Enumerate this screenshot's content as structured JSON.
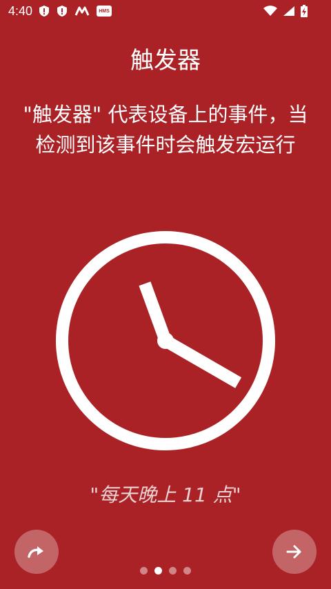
{
  "status_bar": {
    "time": "4:40",
    "hms_label": "HMS",
    "left_icons": [
      "shield-icon",
      "shield-icon",
      "m-logo-icon",
      "hms-badge"
    ],
    "right_icons": [
      "wifi-icon",
      "signal-icon",
      "battery-icon"
    ]
  },
  "intro": {
    "title": "触发器",
    "description": "\"触发器\" 代表设备上的事件，当检测到该事件时会触发宏运行",
    "caption": "\"每天晚上 11 点\"",
    "clock": {
      "hour": 11,
      "minute": 20
    }
  },
  "buttons": {
    "skip_icon": "skip-arrow-icon",
    "next_icon": "arrow-right-icon"
  },
  "pager": {
    "total": 4,
    "active_index": 1
  },
  "colors": {
    "background": "#AA2226",
    "foreground": "#FFFFFF",
    "caption": "#E9D2D3"
  }
}
